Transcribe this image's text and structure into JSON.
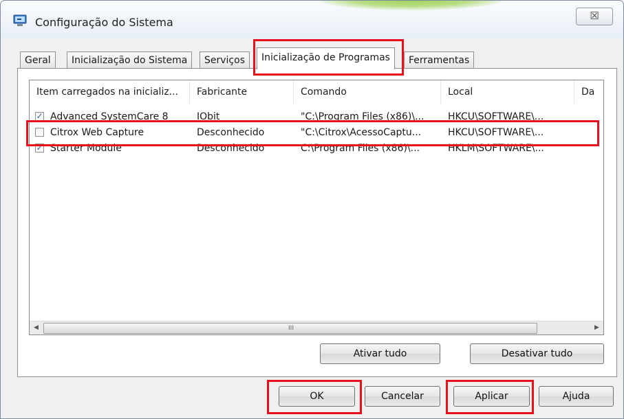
{
  "window": {
    "title": "Configuração do Sistema",
    "close_label": "☒"
  },
  "tabs": [
    {
      "label": "Geral",
      "active": false
    },
    {
      "label": "Inicialização do Sistema",
      "active": false
    },
    {
      "label": "Serviços",
      "active": false
    },
    {
      "label": "Inicialização de Programas",
      "active": true
    },
    {
      "label": "Ferramentas",
      "active": false
    }
  ],
  "startup_list": {
    "columns": [
      "Item carregados na inicializ...",
      "Fabricante",
      "Comando",
      "Local",
      "Da"
    ],
    "rows": [
      {
        "checked": true,
        "item": "Advanced SystemCare 8",
        "manufacturer": "IObit",
        "command": "\"C:\\Program Files (x86)\\...",
        "location": "HKCU\\SOFTWARE\\..."
      },
      {
        "checked": false,
        "item": "Citrox Web Capture",
        "manufacturer": "Desconhecido",
        "command": "\"C:\\Citrox\\AcessoCaptu...",
        "location": "HKCU\\SOFTWARE\\..."
      },
      {
        "checked": true,
        "item": "Starter Module",
        "manufacturer": "Desconhecido",
        "command": "C:\\Program Files (x86)\\...",
        "location": "HKLM\\SOFTWARE\\..."
      }
    ],
    "scroll_grip": "III"
  },
  "panel_buttons": {
    "enable_all": "Ativar tudo",
    "disable_all": "Desativar tudo"
  },
  "dialog_buttons": {
    "ok": "OK",
    "cancel": "Cancelar",
    "apply": "Aplicar",
    "help": "Ajuda"
  },
  "colors": {
    "highlight": "#e8101c",
    "titlebar_glow": "#9ed15a",
    "checkbox_check": "#3a5ea8"
  },
  "icons": [
    "system-config-icon",
    "close-icon",
    "checkmark-icon",
    "scroll-left-icon",
    "scroll-right-icon"
  ]
}
